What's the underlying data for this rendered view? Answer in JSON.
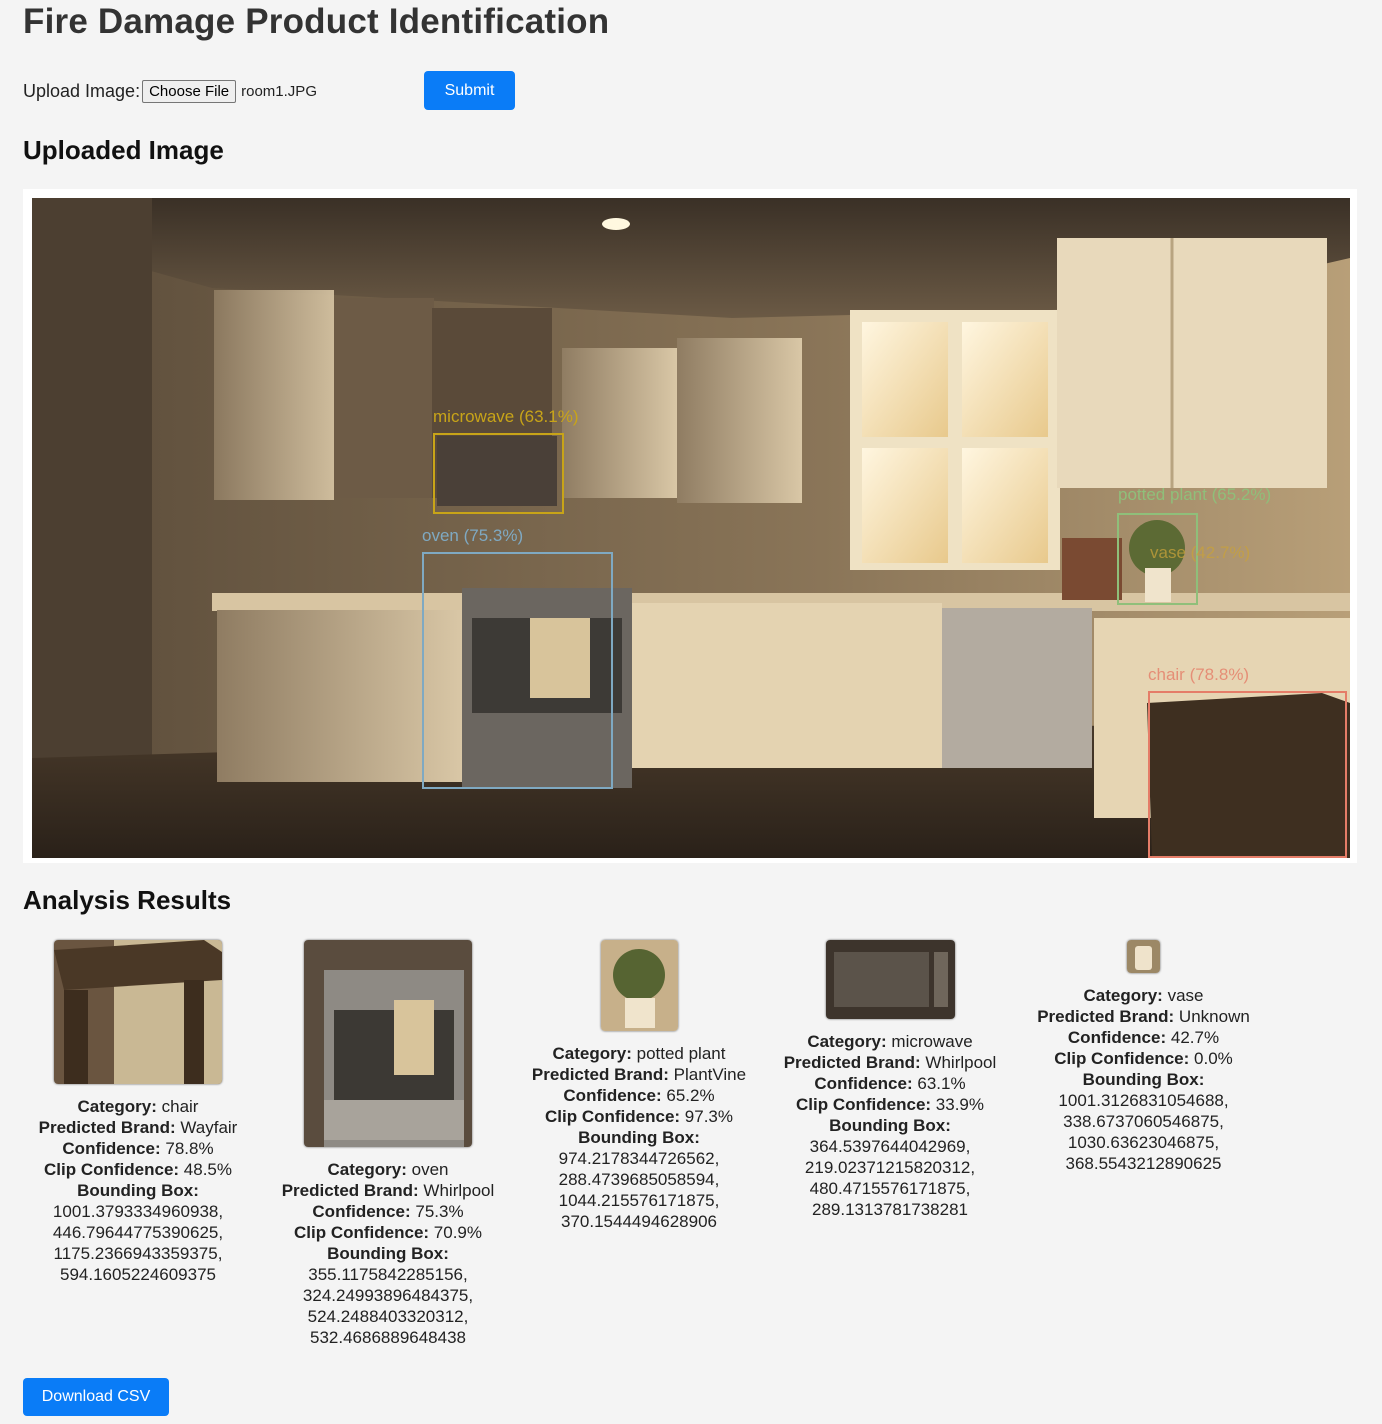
{
  "page": {
    "title": "Fire Damage Product Identification"
  },
  "upload": {
    "label": "Upload Image:",
    "choose_label": "Choose File",
    "file_name": "room1.JPG",
    "submit_label": "Submit"
  },
  "sections": {
    "uploaded_heading": "Uploaded Image",
    "results_heading": "Analysis Results"
  },
  "detections": [
    {
      "label": "microwave (63.1%)",
      "color": "#c8a418"
    },
    {
      "label": "oven (75.3%)",
      "color": "#7fa9c2"
    },
    {
      "label": "potted plant (65.2%)",
      "color": "#8fbf7a"
    },
    {
      "label": "vase (42.7%)",
      "color": "#c9a23a"
    },
    {
      "label": "chair (78.8%)",
      "color": "#e57d68"
    }
  ],
  "results": [
    {
      "category": "chair",
      "brand": "Wayfair",
      "confidence": "78.8%",
      "clip_confidence": "48.5%",
      "bbox": [
        "1001.3793334960938,",
        "446.79644775390625,",
        "1175.2366943359375,",
        "594.1605224609375"
      ]
    },
    {
      "category": "oven",
      "brand": "Whirlpool",
      "confidence": "75.3%",
      "clip_confidence": "70.9%",
      "bbox": [
        "355.1175842285156,",
        "324.24993896484375,",
        "524.2488403320312,",
        "532.4686889648438"
      ]
    },
    {
      "category": "potted plant",
      "brand": "PlantVine",
      "confidence": "65.2%",
      "clip_confidence": "97.3%",
      "bbox": [
        "974.2178344726562,",
        "288.4739685058594,",
        "1044.215576171875,",
        "370.1544494628906"
      ]
    },
    {
      "category": "microwave",
      "brand": "Whirlpool",
      "confidence": "63.1%",
      "clip_confidence": "33.9%",
      "bbox": [
        "364.5397644042969,",
        "219.02371215820312,",
        "480.4715576171875,",
        "289.1313781738281"
      ]
    },
    {
      "category": "vase",
      "brand": "Unknown",
      "confidence": "42.7%",
      "clip_confidence": "0.0%",
      "bbox": [
        "1001.3126831054688,",
        "338.6737060546875,",
        "1030.63623046875,",
        "368.5543212890625"
      ]
    }
  ],
  "field_labels": {
    "category": "Category:",
    "brand": "Predicted Brand:",
    "confidence": "Confidence:",
    "clip_confidence": "Clip Confidence:",
    "bbox": "Bounding Box:"
  },
  "download_label": "Download CSV"
}
